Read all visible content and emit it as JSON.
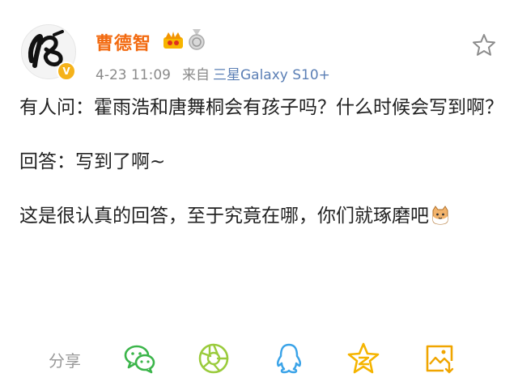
{
  "post": {
    "username": "曹德智",
    "time": "4-23 11:09",
    "source_prefix": "来自",
    "device": "三星Galaxy S10+",
    "paragraphs": [
      "有人问：霍雨浩和唐舞桐会有孩子吗？什么时候会写到啊？",
      "回答：写到了啊~",
      "这是很认真的回答，至于究竟在哪，你们就琢磨吧"
    ],
    "avatar_text": "18",
    "verified_badge": "V"
  },
  "share": {
    "label": "分享",
    "icons": [
      "wechat-icon",
      "moments-icon",
      "qq-icon",
      "qzone-icon",
      "save-image-icon"
    ]
  },
  "colors": {
    "username": "#f26a10",
    "device": "#5b7fb5",
    "meta": "#8a8a8a",
    "wechat": "#3bb54a",
    "moments": "#9acb3c",
    "qq": "#3aa3e8",
    "qzone": "#f5b400",
    "save": "#f0a500"
  }
}
